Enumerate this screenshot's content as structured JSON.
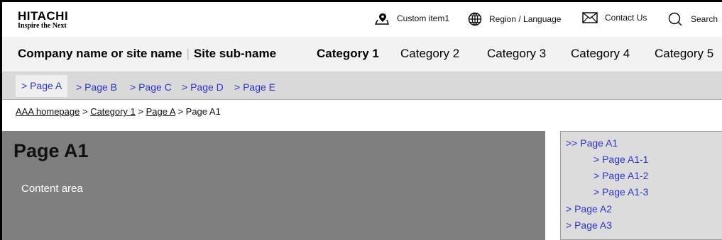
{
  "logo": {
    "brand": "HITACHI",
    "tagline": "Inspire the Next"
  },
  "utility": [
    {
      "label": "Custom item1",
      "icon": "location-pin-icon"
    },
    {
      "label": "Region / Language",
      "icon": "globe-icon"
    },
    {
      "label": "Contact Us",
      "icon": "mail-icon"
    },
    {
      "label": "Search",
      "icon": "search-icon"
    }
  ],
  "global_nav": {
    "site_name": "Company name or site name",
    "separator": "|",
    "site_subname": "Site sub-name",
    "categories": [
      "Category 1",
      "Category 2",
      "Category 3",
      "Category 4",
      "Category 5"
    ],
    "active_category": "Category 1"
  },
  "local_nav": [
    "> Page A",
    "> Page B",
    "> Page C",
    "> Page D",
    "> Page E"
  ],
  "breadcrumb": {
    "items": [
      "AAA homepage",
      "Category 1",
      "Page A",
      "Page A1"
    ],
    "separator": " > "
  },
  "main": {
    "title": "Page A1",
    "content": "Content area"
  },
  "side_nav": [
    ">> Page A1",
    "> Page A1-1",
    "> Page A1-2",
    "> Page A1-3",
    "> Page A2",
    "> Page A3"
  ],
  "colors": {
    "link": "#2a34c9",
    "content_bg": "#7f7f7f",
    "nav_bg": "#f2f2f2",
    "local_nav_bg": "#d9d9d9",
    "side_bg": "#dcdcdc"
  }
}
